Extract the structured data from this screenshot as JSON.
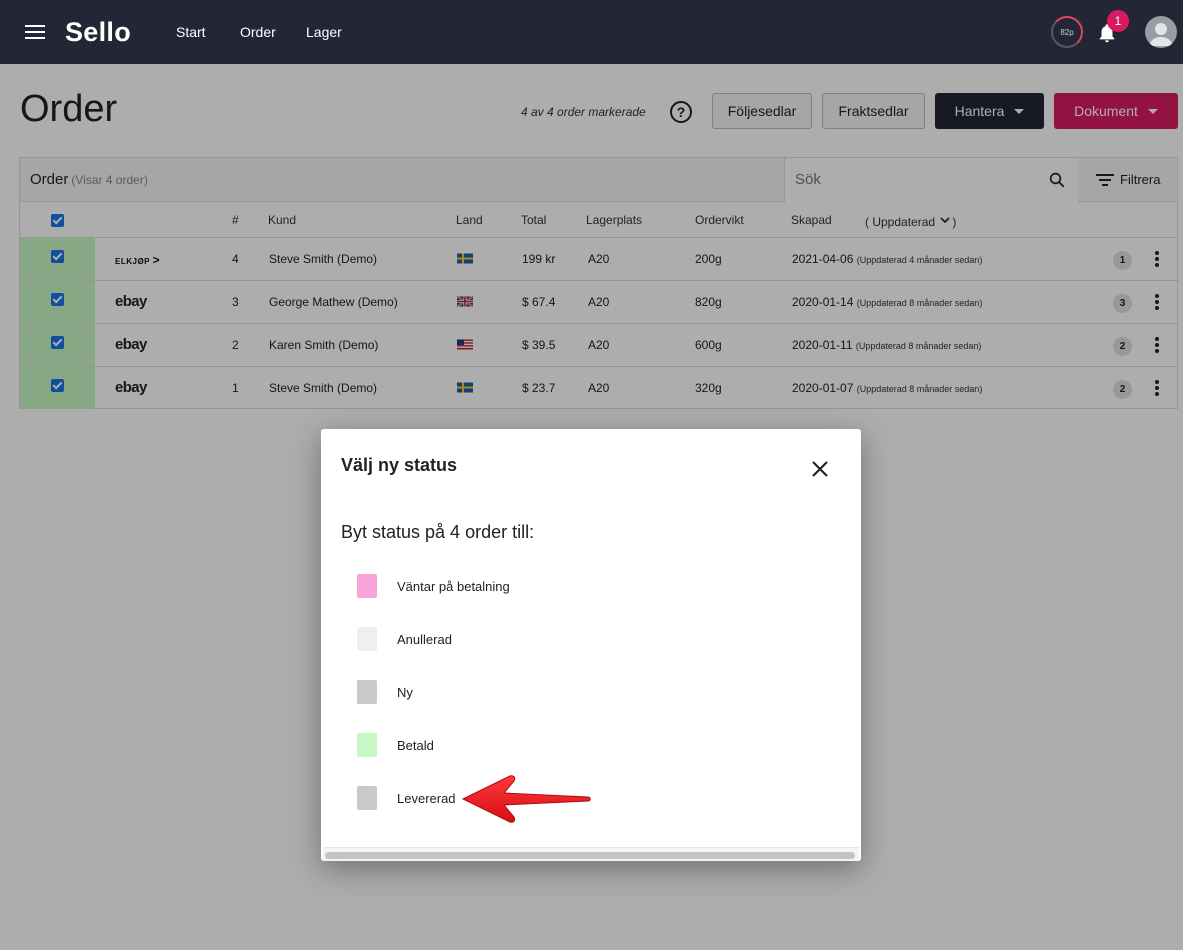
{
  "topbar": {
    "logo": "Sello",
    "nav": [
      "Start",
      "Order",
      "Lager"
    ],
    "score": "82p",
    "notifications": "1"
  },
  "header": {
    "title": "Order",
    "marked": "4 av 4 order markerade",
    "buttons": {
      "packing": "Följesedlar",
      "freight": "Fraktsedlar",
      "manage": "Hantera",
      "documents": "Dokument"
    }
  },
  "table": {
    "title": "Order",
    "subtitle": "(Visar 4 order)",
    "search_placeholder": "Sök",
    "filter": "Filtrera",
    "headers": {
      "num": "#",
      "customer": "Kund",
      "country": "Land",
      "total": "Total",
      "location": "Lagerplats",
      "weight": "Ordervikt",
      "created": "Skapad",
      "updated": "( Uppdaterad",
      "updated_end": ")"
    },
    "rows": [
      {
        "channel": "ELKJØP",
        "num": "4",
        "customer": "Steve Smith (Demo)",
        "country": "SE",
        "total": "199 kr",
        "location": "A20",
        "weight": "200g",
        "created": "2021-04-06",
        "updated": "(Uppdaterad 4 månader sedan)",
        "count": "1"
      },
      {
        "channel": "ebay",
        "num": "3",
        "customer": "George Mathew (Demo)",
        "country": "GB",
        "total": "$ 67.4",
        "location": "A20",
        "weight": "820g",
        "created": "2020-01-14",
        "updated": "(Uppdaterad 8 månader sedan)",
        "count": "3"
      },
      {
        "channel": "ebay",
        "num": "2",
        "customer": "Karen Smith (Demo)",
        "country": "US",
        "total": "$ 39.5",
        "location": "A20",
        "weight": "600g",
        "created": "2020-01-11",
        "updated": "(Uppdaterad 8 månader sedan)",
        "count": "2"
      },
      {
        "channel": "ebay",
        "num": "1",
        "customer": "Steve Smith (Demo)",
        "country": "SE",
        "total": "$ 23.7",
        "location": "A20",
        "weight": "320g",
        "created": "2020-01-07",
        "updated": "(Uppdaterad 8 månader sedan)",
        "count": "2"
      }
    ]
  },
  "modal": {
    "title": "Välj ny status",
    "lead": "Byt status på 4 order till:",
    "options": [
      {
        "label": "Väntar på betalning",
        "color": "#f9a3d9"
      },
      {
        "label": "Anullerad",
        "color": "#efefef"
      },
      {
        "label": "Ny",
        "color": "#c9c9c9"
      },
      {
        "label": "Betald",
        "color": "#c6f7c4"
      },
      {
        "label": "Levererad",
        "color": "#c9c9c9"
      }
    ]
  },
  "colors": {
    "topbar": "#232735",
    "accent_pink": "#d81b60",
    "selected_row": "#c8f7c5",
    "arrow": "#e8141b"
  }
}
